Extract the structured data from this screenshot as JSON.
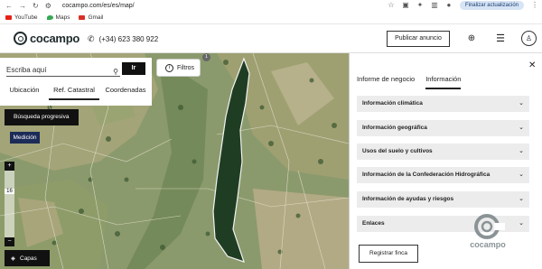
{
  "browser": {
    "url": "cocampo.com/es/es/map/",
    "update_label": "Finalizar actualización",
    "bookmarks": [
      {
        "label": "YouTube",
        "color": "#e62117"
      },
      {
        "label": "Maps",
        "color": "#34a853"
      },
      {
        "label": "Gmail",
        "color": "#d93025"
      }
    ]
  },
  "header": {
    "logo_text": "cocampo",
    "phone": "(+34) 623 380 922",
    "publish_label": "Publicar anuncio"
  },
  "search": {
    "placeholder": "Escriba aquí",
    "go_label": "Ir",
    "tabs": [
      "Ubicación",
      "Ref. Catastral",
      "Coordenadas"
    ],
    "active_tab": "Ref. Catastral"
  },
  "map": {
    "filter_label": "Filtros",
    "filter_count": "1",
    "progressive_search_label": "Búsqueda progresiva",
    "measure_label": "Medición",
    "zoom_level": "16",
    "layers_label": "Capas",
    "parcel_color": "#1f3d22"
  },
  "panel": {
    "tabs": [
      "Informe de negocio",
      "Información"
    ],
    "active_tab": "Información",
    "sections": [
      "Información climática",
      "Información geográfica",
      "Usos del suelo y cultivos",
      "Información de la Confederación Hidrográfica",
      "Información de ayudas y riesgos",
      "Enlaces"
    ],
    "register_label": "Registrar finca",
    "watermark_text": "cocampo"
  }
}
